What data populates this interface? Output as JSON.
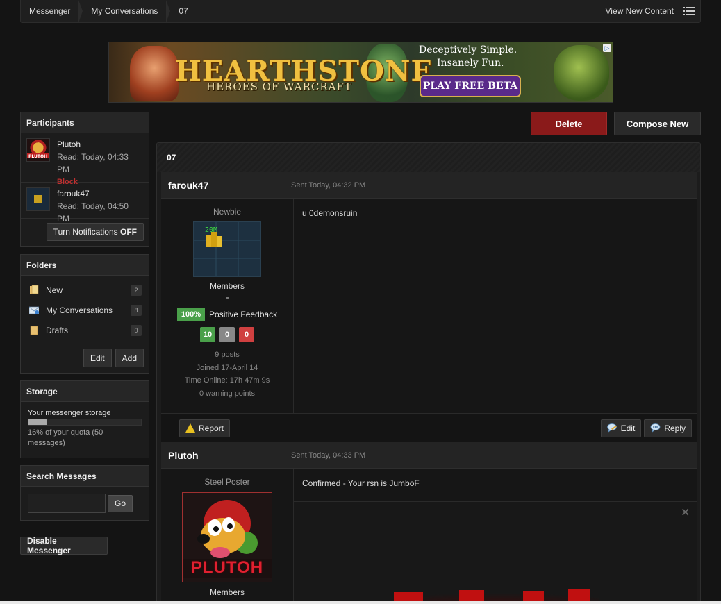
{
  "breadcrumb": [
    "Messenger",
    "My Conversations",
    "07"
  ],
  "topbar": {
    "view_new": "View New Content"
  },
  "banner": {
    "logo": "HEARTHSTONE",
    "subtitle": "HEROES OF WARCRAFT",
    "tagline1": "Deceptively Simple.",
    "tagline2": "Insanely Fun.",
    "cta": "PLAY FREE BETA",
    "adchoice": "▷"
  },
  "participants": {
    "title": "Participants",
    "items": [
      {
        "name": "Plutoh",
        "read": "Read: Today, 04:33 PM",
        "action": "Block"
      },
      {
        "name": "farouk47",
        "read": "Read: Today, 04:50 PM"
      }
    ],
    "notify_prefix": "Turn Notifications ",
    "notify_state": "OFF"
  },
  "folders": {
    "title": "Folders",
    "items": [
      {
        "label": "New",
        "count": "2"
      },
      {
        "label": "My Conversations",
        "count": "8"
      },
      {
        "label": "Drafts",
        "count": "0"
      }
    ],
    "edit": "Edit",
    "add": "Add"
  },
  "storage": {
    "title": "Storage",
    "label": "Your messenger storage",
    "percent": 16,
    "quota_text": "16% of your quota (50 messages)"
  },
  "search": {
    "title": "Search Messages",
    "value": "",
    "go": "Go"
  },
  "disable": "Disable Messenger",
  "actions": {
    "delete": "Delete",
    "compose": "Compose New"
  },
  "conversation": {
    "title": "07",
    "posts": [
      {
        "author": "farouk47",
        "date": "Sent Today, 04:32 PM",
        "rank": "Newbie",
        "avatar_text": "20M",
        "group": "Members",
        "feedback_pct": "100%",
        "feedback_label": "Positive Feedback",
        "fb_pos": "10",
        "fb_neu": "0",
        "fb_neg": "0",
        "posts": "9 posts",
        "joined": "Joined 17-April 14",
        "online": "Time Online: 17h 47m 9s",
        "warnings": "0 warning points",
        "message": "u 0demonsruin",
        "report": "Report",
        "edit": "Edit",
        "reply": "Reply"
      },
      {
        "author": "Plutoh",
        "date": "Sent Today, 04:33 PM",
        "rank": "Steel Poster",
        "avatar_text": "PLUTOH",
        "group": "Members",
        "message": "Confirmed - Your rsn is JumboF",
        "close": "✕"
      }
    ]
  },
  "colors": {
    "background": "#141414",
    "delete": "#8a1a1a",
    "positive": "#4aa04a",
    "neutral": "#888888",
    "negative": "#d04040",
    "block": "#c03030"
  }
}
